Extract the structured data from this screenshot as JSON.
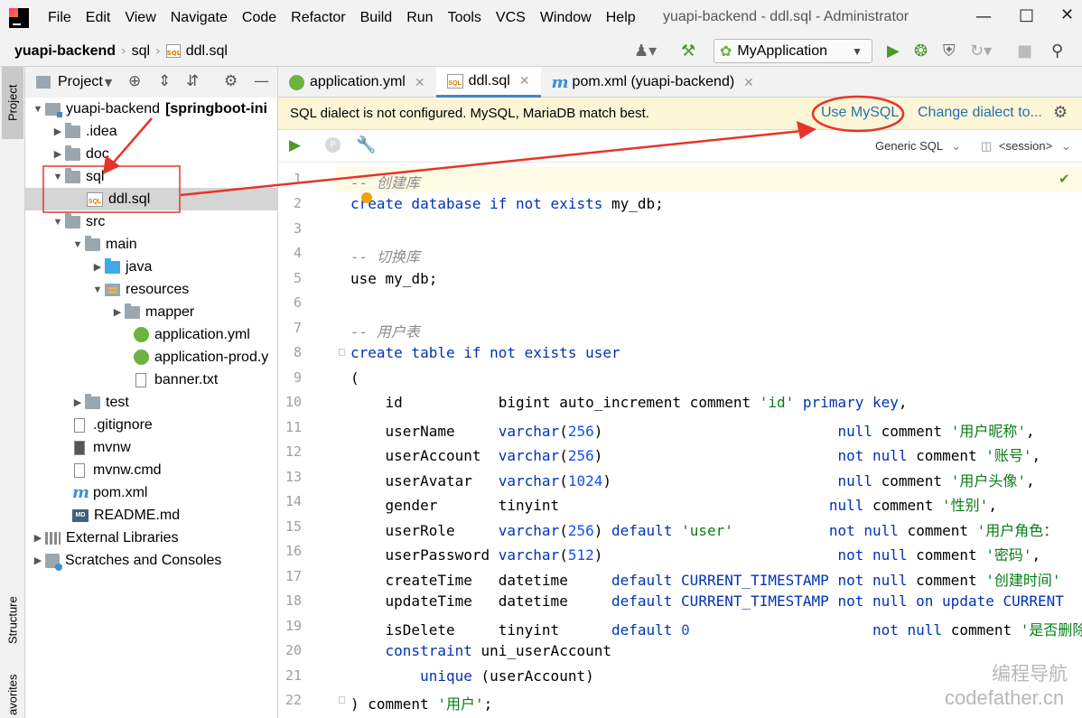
{
  "menubar": {
    "items": [
      "File",
      "Edit",
      "View",
      "Navigate",
      "Code",
      "Refactor",
      "Build",
      "Run",
      "Tools",
      "VCS",
      "Window",
      "Help"
    ],
    "window_title": "yuapi-backend - ddl.sql - Administrator"
  },
  "navbar": {
    "project": "yuapi-backend",
    "folder": "sql",
    "file": "ddl.sql",
    "run_config": "MyApplication"
  },
  "left_strip": {
    "project_tab": "Project",
    "structure_tab": "Structure",
    "favorites_tab": "avorites"
  },
  "project_panel": {
    "title": "Project",
    "tree": [
      {
        "label": "yuapi-backend",
        "hint": "[springboot-ini",
        "icon": "module-icon"
      },
      {
        "label": ".idea",
        "icon": "folder-icon"
      },
      {
        "label": "doc",
        "icon": "folder-icon"
      },
      {
        "label": "sql",
        "icon": "folder-icon"
      },
      {
        "label": "ddl.sql",
        "icon": "sql-file-icon"
      },
      {
        "label": "src",
        "icon": "folder-icon"
      },
      {
        "label": "main",
        "icon": "folder-icon"
      },
      {
        "label": "java",
        "icon": "source-folder-icon"
      },
      {
        "label": "resources",
        "icon": "resources-folder-icon"
      },
      {
        "label": "mapper",
        "icon": "folder-icon"
      },
      {
        "label": "application.yml",
        "icon": "spring-config-icon"
      },
      {
        "label": "application-prod.y",
        "icon": "spring-config-icon"
      },
      {
        "label": "banner.txt",
        "icon": "text-file-icon"
      },
      {
        "label": "test",
        "icon": "folder-icon"
      },
      {
        "label": ".gitignore",
        "icon": "text-file-icon"
      },
      {
        "label": "mvnw",
        "icon": "script-file-icon"
      },
      {
        "label": "mvnw.cmd",
        "icon": "text-file-icon"
      },
      {
        "label": "pom.xml",
        "icon": "maven-icon",
        "icon_glyph": "m"
      },
      {
        "label": "README.md",
        "icon": "markdown-icon",
        "icon_glyph": "MD"
      },
      {
        "label": "External Libraries",
        "icon": "library-icon"
      },
      {
        "label": "Scratches and Consoles",
        "icon": "scratch-icon"
      }
    ]
  },
  "editor_tabs": [
    {
      "label": "application.yml",
      "icon": "spring-config-icon"
    },
    {
      "label": "ddl.sql",
      "icon": "sql-file-icon",
      "icon_glyph": "SQL"
    },
    {
      "label": "pom.xml (yuapi-backend)",
      "icon": "maven-icon",
      "icon_glyph": "m"
    }
  ],
  "notification": {
    "message": "SQL dialect is not configured. MySQL, MariaDB match best.",
    "use_mysql": "Use MySQL",
    "change_dialect": "Change dialect to..."
  },
  "editor_toolbar": {
    "dialect": "Generic SQL",
    "session": "<session>"
  },
  "code": {
    "line_numbers": [
      "1",
      "2",
      "3",
      "4",
      "5",
      "6",
      "7",
      "8",
      "9",
      "10",
      "11",
      "12",
      "13",
      "14",
      "15",
      "16",
      "17",
      "18",
      "19",
      "20",
      "21",
      "22"
    ],
    "t1": "-- 创建库",
    "t2a": "create database if not exists",
    "t2b": " my_db;",
    "t4": "-- 切换库",
    "t5a": "use",
    "t5b": " my_db;",
    "t7": "-- 用户表",
    "t8a": "create table if not exists",
    "t8b": "user",
    "t9": "(",
    "t10a": "    id           bigint auto_increment comment ",
    "t10b": "'id'",
    "t10c": " primary key",
    "t10d": ",",
    "t11a": "    userName     ",
    "t11b": "varchar",
    "t11c": "(",
    "t11d": "256",
    "t11e": ")                           ",
    "t11f": "null",
    "t11g": " comment ",
    "t11h": "'用户昵称'",
    "t11i": ",",
    "t12a": "    userAccount  ",
    "t12b": "varchar",
    "t12c": "(",
    "t12d": "256",
    "t12e": ")                           ",
    "t12f": "not null",
    "t12g": " comment ",
    "t12h": "'账号'",
    "t12i": ",",
    "t13a": "    userAvatar   ",
    "t13b": "varchar",
    "t13c": "(",
    "t13d": "1024",
    "t13e": ")                          ",
    "t13f": "null",
    "t13g": " comment ",
    "t13h": "'用户头像'",
    "t13i": ",",
    "t14a": "    gender       tinyint                               ",
    "t14f": "null",
    "t14g": " comment ",
    "t14h": "'性别'",
    "t14i": ",",
    "t15a": "    userRole     ",
    "t15b": "varchar",
    "t15c": "(",
    "t15d": "256",
    "t15e": ") ",
    "t15x": "default",
    "t15y": " ",
    "t15z": "'user'",
    "t15w": "           ",
    "t15f": "not null",
    "t15g": " comment ",
    "t15h": "'用户角色：",
    "t16a": "    userPassword ",
    "t16b": "varchar",
    "t16c": "(",
    "t16d": "512",
    "t16e": ")                           ",
    "t16f": "not null",
    "t16g": " comment ",
    "t16h": "'密码'",
    "t16i": ",",
    "t17a": "    createTime   datetime     ",
    "t17b": "default CURRENT_TIMESTAMP",
    "t17c": " ",
    "t17d": "not null",
    "t17e": " comment ",
    "t17f": "'创建时间'",
    "t18a": "    updateTime   datetime     ",
    "t18b": "default CURRENT_TIMESTAMP",
    "t18c": " ",
    "t18d": "not null on update CURRENT",
    "t19a": "    isDelete     tinyint      ",
    "t19b": "default",
    "t19c": " ",
    "t19d": "0",
    "t19e": "                     ",
    "t19f": "not null",
    "t19g": " comment ",
    "t19h": "'是否删除'",
    "t20a": "    ",
    "t20b": "constraint",
    "t20c": " uni_userAccount",
    "t21a": "        ",
    "t21b": "unique",
    "t21c": " (userAccount)",
    "t22a": ") comment ",
    "t22b": "'用户'",
    "t22c": ";"
  },
  "watermark": {
    "line1": "编程导航",
    "line2": "codefather.cn"
  },
  "colors": {
    "keyword": "#0033b3",
    "string": "#067d17",
    "comment": "#8c8c8c",
    "number": "#1750eb",
    "annotation_red": "#e8332a",
    "link": "#2470b3",
    "notification_bg": "#fcf6d6"
  }
}
